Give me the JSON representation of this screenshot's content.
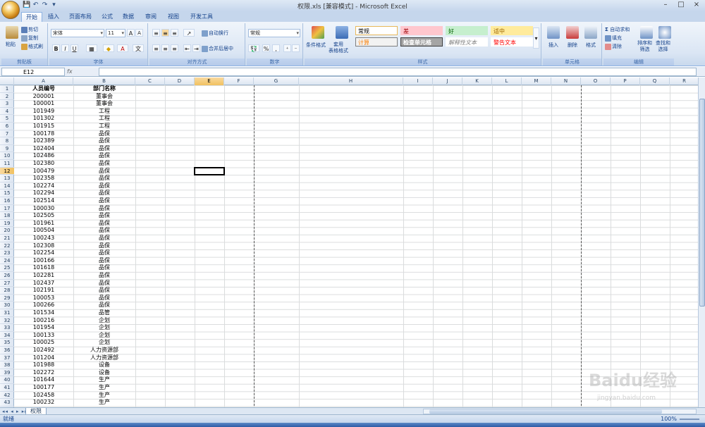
{
  "window": {
    "title": "权限.xls  [兼容模式] - Microsoft Excel",
    "minimize": "–",
    "maximize": "□",
    "close": "×"
  },
  "qat": [
    "💾",
    "↶",
    "↷",
    "▾"
  ],
  "tabs": [
    "开始",
    "插入",
    "页面布局",
    "公式",
    "数据",
    "审阅",
    "视图",
    "开发工具"
  ],
  "ribbon": {
    "clipboard": {
      "label": "剪贴板",
      "paste": "粘贴",
      "cut": "剪切",
      "copy": "复制",
      "format_painter": "格式刷"
    },
    "font": {
      "label": "字体",
      "font_name": "宋体",
      "font_size": "11",
      "bold": "B",
      "italic": "I",
      "underline": "U"
    },
    "alignment": {
      "label": "对齐方式",
      "wrap": "自动换行",
      "merge": "合并后居中"
    },
    "number": {
      "label": "数字",
      "format": "常规",
      "percent": "%",
      "comma": ","
    },
    "styles": {
      "label": "样式",
      "cond_format": "条件格式",
      "table_format": "套用\n表格格式",
      "items": [
        {
          "text": "常规",
          "color": "#ffffff",
          "fg": "#000000",
          "border": "#e8b85a"
        },
        {
          "text": "差",
          "color": "#ffc7ce",
          "fg": "#9c0006",
          "border": "#ffc7ce"
        },
        {
          "text": "好",
          "color": "#c6efce",
          "fg": "#006100",
          "border": "#c6efce"
        },
        {
          "text": "适中",
          "color": "#ffeb9c",
          "fg": "#9c6500",
          "border": "#ffeb9c"
        },
        {
          "text": "计算",
          "color": "#f2f2f2",
          "fg": "#fa7d00",
          "border": "#7f7f7f"
        },
        {
          "text": "检查单元格",
          "color": "#a5a5a5",
          "fg": "#ffffff",
          "border": "#3f3f3f"
        },
        {
          "text": "解释性文本",
          "color": "#ffffff",
          "fg": "#7f7f7f",
          "border": "#ffffff"
        },
        {
          "text": "警告文本",
          "color": "#ffffff",
          "fg": "#ff0000",
          "border": "#ffffff"
        }
      ]
    },
    "cells": {
      "label": "单元格",
      "insert": "插入",
      "delete": "删除",
      "format": "格式"
    },
    "editing": {
      "label": "编辑",
      "autosum": "自动求和",
      "fill": "填充",
      "clear": "清除",
      "sort": "排序和\n筛选",
      "find": "查找和\n选择"
    }
  },
  "formula_bar": {
    "name_box": "E12",
    "fx": "fx",
    "value": ""
  },
  "columns": [
    "A",
    "B",
    "C",
    "D",
    "E",
    "F",
    "G",
    "H",
    "I",
    "J",
    "K",
    "L",
    "M",
    "N",
    "O",
    "P",
    "Q",
    "R"
  ],
  "selected_col": "E",
  "selected_row": "12",
  "header_row": {
    "a": "人员编号",
    "b": "部门名称"
  },
  "rows": [
    [
      "200001",
      "董事会"
    ],
    [
      "100001",
      "董事会"
    ],
    [
      "101949",
      "工程"
    ],
    [
      "101302",
      "工程"
    ],
    [
      "101915",
      "工程"
    ],
    [
      "100178",
      "品保"
    ],
    [
      "102389",
      "品保"
    ],
    [
      "102404",
      "品保"
    ],
    [
      "102486",
      "品保"
    ],
    [
      "102380",
      "品保"
    ],
    [
      "100479",
      "品保"
    ],
    [
      "102358",
      "品保"
    ],
    [
      "102274",
      "品保"
    ],
    [
      "102294",
      "品保"
    ],
    [
      "102514",
      "品保"
    ],
    [
      "100030",
      "品保"
    ],
    [
      "102505",
      "品保"
    ],
    [
      "101961",
      "品保"
    ],
    [
      "100504",
      "品保"
    ],
    [
      "100243",
      "品保"
    ],
    [
      "102308",
      "品保"
    ],
    [
      "102254",
      "品保"
    ],
    [
      "100166",
      "品保"
    ],
    [
      "101618",
      "品保"
    ],
    [
      "102281",
      "品保"
    ],
    [
      "102437",
      "品保"
    ],
    [
      "102191",
      "品保"
    ],
    [
      "100053",
      "品保"
    ],
    [
      "100266",
      "品保"
    ],
    [
      "101534",
      "品管"
    ],
    [
      "100216",
      "企划"
    ],
    [
      "101954",
      "企划"
    ],
    [
      "100133",
      "企划"
    ],
    [
      "100025",
      "企划"
    ],
    [
      "102492",
      "人力资源部"
    ],
    [
      "101204",
      "人力资源部"
    ],
    [
      "101988",
      "设备"
    ],
    [
      "102272",
      "设备"
    ],
    [
      "101644",
      "生产"
    ],
    [
      "100177",
      "生产"
    ],
    [
      "102458",
      "生产"
    ],
    [
      "100232",
      "生产"
    ]
  ],
  "row_numbers": [
    "1",
    "2",
    "3",
    "4",
    "5",
    "6",
    "7",
    "8",
    "9",
    "10",
    "11",
    "12",
    "13",
    "14",
    "15",
    "16",
    "17",
    "18",
    "19",
    "20",
    "21",
    "22",
    "23",
    "24",
    "25",
    "26",
    "27",
    "28",
    "29",
    "30",
    "31",
    "32",
    "33",
    "34",
    "35",
    "36",
    "37",
    "38",
    "39",
    "40",
    "41",
    "42",
    "43"
  ],
  "sheet": {
    "nav": "◂◂ ◂ ▸ ▸▸",
    "tab": "权限"
  },
  "status": {
    "ready": "就绪",
    "zoom": "100%"
  },
  "watermark": {
    "brand": "Baidu经验",
    "url": "jingyan.baidu.com"
  }
}
